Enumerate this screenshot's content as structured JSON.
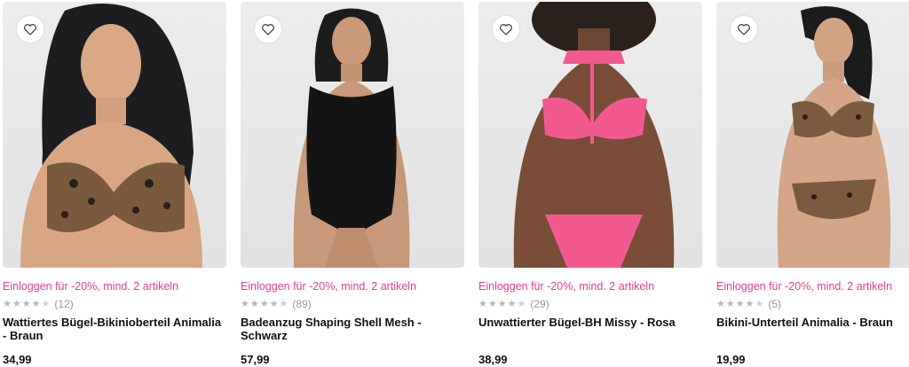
{
  "products": [
    {
      "promo": "Einloggen für -20%, mind. 2 artikeln",
      "rating": 4.5,
      "reviews": "(12)",
      "title": "Wattiertes Bügel-Bikinioberteil Animalia - Braun",
      "price": "34,99"
    },
    {
      "promo": "Einloggen für -20%, mind. 2 artikeln",
      "rating": 4.5,
      "reviews": "(89)",
      "title": "Badeanzug Shaping Shell Mesh - Schwarz",
      "price": "57,99"
    },
    {
      "promo": "Einloggen für -20%, mind. 2 artikeln",
      "rating": 4.5,
      "reviews": "(29)",
      "title": "Unwattierter Bügel-BH Missy - Rosa",
      "price": "38,99"
    },
    {
      "promo": "Einloggen für -20%, mind. 2 artikeln",
      "rating": 4.5,
      "reviews": "(5)",
      "title": "Bikini-Unterteil Animalia - Braun",
      "price": "19,99"
    }
  ],
  "colors": {
    "promo": "#e23f8d",
    "star": "#b7b7b7",
    "photo_bg": "#e6e6e6"
  },
  "icons": {
    "wishlist": "heart-outline-icon",
    "star": "star-icon"
  }
}
